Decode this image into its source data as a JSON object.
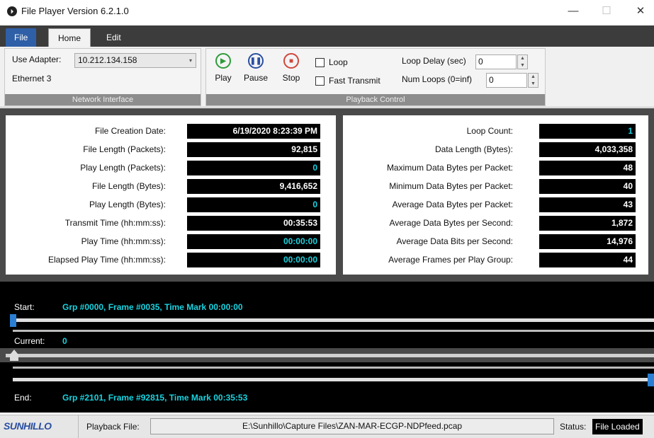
{
  "window": {
    "title": "File Player Version 6.2.1.0",
    "min": "—",
    "max": "☐",
    "close": "✕"
  },
  "tabs": {
    "file": "File",
    "home": "Home",
    "edit": "Edit"
  },
  "network": {
    "adapter_label": "Use Adapter:",
    "adapter_value": "10.212.134.158",
    "adapter_name": "Ethernet 3",
    "group_label": "Network Interface"
  },
  "playback": {
    "play": "Play",
    "pause": "Pause",
    "stop": "Stop",
    "loop": "Loop",
    "fast": "Fast Transmit",
    "loop_delay_label": "Loop Delay (sec)",
    "loop_delay_value": "0",
    "num_loops_label": "Num Loops (0=inf)",
    "num_loops_value": "0",
    "group_label": "Playback Control"
  },
  "left_stats": [
    {
      "label": "File Creation Date:",
      "value": "6/19/2020 8:23:39 PM",
      "color": "white"
    },
    {
      "label": "File Length (Packets):",
      "value": "92,815",
      "color": "white"
    },
    {
      "label": "Play Length (Packets):",
      "value": "0",
      "color": "cyan"
    },
    {
      "label": "File Length (Bytes):",
      "value": "9,416,652",
      "color": "white"
    },
    {
      "label": "Play Length (Bytes):",
      "value": "0",
      "color": "cyan"
    },
    {
      "label": "Transmit Time (hh:mm:ss):",
      "value": "00:35:53",
      "color": "white"
    },
    {
      "label": "Play Time (hh:mm:ss):",
      "value": "00:00:00",
      "color": "cyan"
    },
    {
      "label": "Elapsed Play Time (hh:mm:ss):",
      "value": "00:00:00",
      "color": "cyan"
    }
  ],
  "right_stats": [
    {
      "label": "Loop Count:",
      "value": "1",
      "color": "cyan"
    },
    {
      "label": "Data Length (Bytes):",
      "value": "4,033,358",
      "color": "white"
    },
    {
      "label": "Maximum Data Bytes per Packet:",
      "value": "48",
      "color": "white"
    },
    {
      "label": "Minimum Data Bytes per Packet:",
      "value": "40",
      "color": "white"
    },
    {
      "label": "Average Data Bytes per Packet:",
      "value": "43",
      "color": "white"
    },
    {
      "label": "Average Data Bytes per Second:",
      "value": "1,872",
      "color": "white"
    },
    {
      "label": "Average Data Bits per Second:",
      "value": "14,976",
      "color": "white"
    },
    {
      "label": "Average Frames per Play Group:",
      "value": "44",
      "color": "white"
    }
  ],
  "timeline": {
    "start_label": "Start:",
    "start_value": "Grp #0000, Frame #0035, Time Mark 00:00:00",
    "current_label": "Current:",
    "current_value": "0",
    "end_label": "End:",
    "end_value": "Grp #2101, Frame #92815, Time Mark 00:35:53",
    "current_position": 0
  },
  "status": {
    "logo": "SUNHILLO",
    "file_label": "Playback File:",
    "file_path": "E:\\Sunhillo\\Capture Files\\ZAN-MAR-ECGP-NDPfeed.pcap",
    "status_label": "Status:",
    "status_value": "File Loaded"
  },
  "colors": {
    "accent": "#2f5fa7",
    "value_cyan": "#19d3e0",
    "play_green": "#2e9b3a",
    "pause_blue": "#2a4fa0",
    "stop_red": "#d0463b"
  }
}
